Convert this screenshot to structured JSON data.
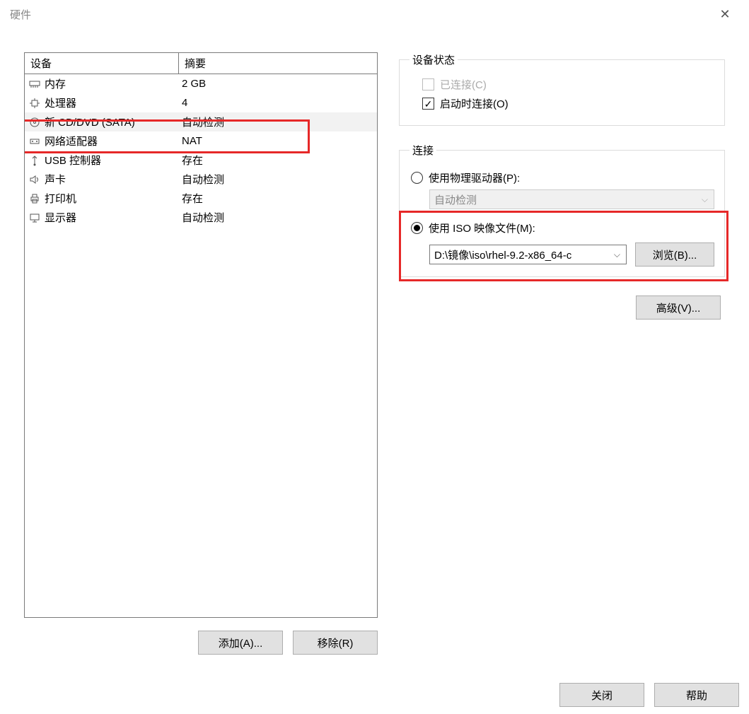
{
  "window": {
    "title": "硬件"
  },
  "device_table": {
    "header_device": "设备",
    "header_summary": "摘要",
    "rows": [
      {
        "name": "内存",
        "summary": "2 GB",
        "icon": "memory"
      },
      {
        "name": "处理器",
        "summary": "4",
        "icon": "cpu"
      },
      {
        "name": "新 CD/DVD (SATA)",
        "summary": "自动检测",
        "icon": "disc",
        "selected": true
      },
      {
        "name": "网络适配器",
        "summary": "NAT",
        "icon": "network"
      },
      {
        "name": "USB 控制器",
        "summary": "存在",
        "icon": "usb"
      },
      {
        "name": "声卡",
        "summary": "自动检测",
        "icon": "sound"
      },
      {
        "name": "打印机",
        "summary": "存在",
        "icon": "printer"
      },
      {
        "name": "显示器",
        "summary": "自动检测",
        "icon": "display"
      }
    ]
  },
  "buttons": {
    "add": "添加(A)...",
    "remove": "移除(R)",
    "browse": "浏览(B)...",
    "advanced": "高级(V)...",
    "close": "关闭",
    "help": "帮助"
  },
  "device_status": {
    "legend": "设备状态",
    "connected": "已连接(C)",
    "connect_at_power_on": "启动时连接(O)"
  },
  "connection": {
    "legend": "连接",
    "use_physical_drive": "使用物理驱动器(P):",
    "physical_drive_value": "自动检测",
    "use_iso": "使用 ISO 映像文件(M):",
    "iso_path": "D:\\镜像\\iso\\rhel-9.2-x86_64-c"
  }
}
